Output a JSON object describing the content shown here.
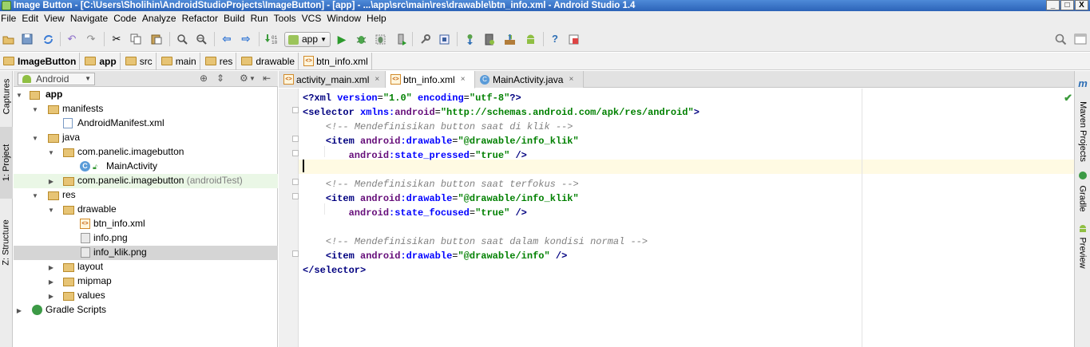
{
  "window": {
    "title": "Image Button - [C:\\Users\\Sholihin\\AndroidStudioProjects\\ImageButton] - [app] - ...\\app\\src\\main\\res\\drawable\\btn_info.xml - Android Studio 1.4",
    "buttons": [
      "_",
      "□",
      "X"
    ]
  },
  "menu": [
    "File",
    "Edit",
    "View",
    "Navigate",
    "Code",
    "Analyze",
    "Refactor",
    "Build",
    "Run",
    "Tools",
    "VCS",
    "Window",
    "Help"
  ],
  "toolbar": {
    "run_config": "app",
    "icons": [
      "open-folder-icon",
      "save-icon",
      "sync-icon",
      "undo-icon",
      "redo-icon",
      "cut-icon",
      "copy-icon",
      "paste-icon",
      "find-icon",
      "replace-icon",
      "back-icon",
      "forward-icon",
      "make-project-icon",
      "run-icon",
      "debug-icon",
      "attach-debugger-icon",
      "run-coverage-icon",
      "project-structure-icon",
      "settings-icon",
      "sync-gradle-icon",
      "avd-manager-icon",
      "sdk-manager-icon",
      "android-monitor-icon",
      "help-icon",
      "stop-icon",
      "search-everywhere-icon",
      "window-icon"
    ]
  },
  "breadcrumb": [
    "ImageButton",
    "app",
    "src",
    "main",
    "res",
    "drawable",
    "btn_info.xml"
  ],
  "left_strip": {
    "captures": "Captures",
    "project": "1: Project",
    "structure": "Z: Structure"
  },
  "right_strip": {
    "maven": "Maven Projects",
    "gradle": "Gradle",
    "preview": "Preview"
  },
  "project_panel": {
    "view": "Android",
    "tree": [
      {
        "label": "app",
        "bold": true
      },
      {
        "label": "manifests"
      },
      {
        "label": "AndroidManifest.xml"
      },
      {
        "label": "java"
      },
      {
        "label": "com.panelic.imagebutton"
      },
      {
        "label": "MainActivity"
      },
      {
        "label": "com.panelic.imagebutton",
        "suffix": "(androidTest)"
      },
      {
        "label": "res"
      },
      {
        "label": "drawable"
      },
      {
        "label": "btn_info.xml"
      },
      {
        "label": "info.png"
      },
      {
        "label": "info_klik.png"
      },
      {
        "label": "layout"
      },
      {
        "label": "mipmap"
      },
      {
        "label": "values"
      },
      {
        "label": "Gradle Scripts"
      }
    ]
  },
  "editor_tabs": [
    {
      "label": "activity_main.xml",
      "close": "×"
    },
    {
      "label": "btn_info.xml",
      "close": "×"
    },
    {
      "label": "MainActivity.java",
      "close": "×"
    }
  ],
  "code": {
    "l1_a": "<?xml ",
    "l1_b": "version",
    "l1_c": "=",
    "l1_d": "\"1.0\"",
    "l1_e": " encoding",
    "l1_f": "=",
    "l1_g": "\"utf-8\"",
    "l1_h": "?>",
    "l2_a": "<selector ",
    "l2_b": "xmlns:",
    "l2_c": "android",
    "l2_d": "=",
    "l2_e": "\"http://schemas.android.com/apk/res/android\"",
    "l2_f": ">",
    "l3": "<!-- Mendefinisikan button saat di klik -->",
    "l4_a": "<item ",
    "l4_b": "android",
    "l4_c": ":drawable",
    "l4_d": "=",
    "l4_e": "\"@drawable/info_klik\"",
    "l5_b": "android",
    "l5_c": ":state_pressed",
    "l5_d": "=",
    "l5_e": "\"true\"",
    "l5_f": " />",
    "l7": "<!-- Mendefinisikan button saat terfokus -->",
    "l8_a": "<item ",
    "l8_b": "android",
    "l8_c": ":drawable",
    "l8_d": "=",
    "l8_e": "\"@drawable/info_klik\"",
    "l9_b": "android",
    "l9_c": ":state_focused",
    "l9_d": "=",
    "l9_e": "\"true\"",
    "l9_f": " />",
    "l11": "<!-- Mendefinisikan button saat dalam kondisi normal -->",
    "l12_a": "<item ",
    "l12_b": "android",
    "l12_c": ":drawable",
    "l12_d": "=",
    "l12_e": "\"@drawable/info\"",
    "l12_f": " />",
    "l13": "</selector>"
  },
  "colors": {
    "tag": "#000080",
    "attribute": "#0000ff",
    "namespace": "#660e7a",
    "value": "#008000",
    "comment": "#808080",
    "caret_line": "#fffae3"
  }
}
